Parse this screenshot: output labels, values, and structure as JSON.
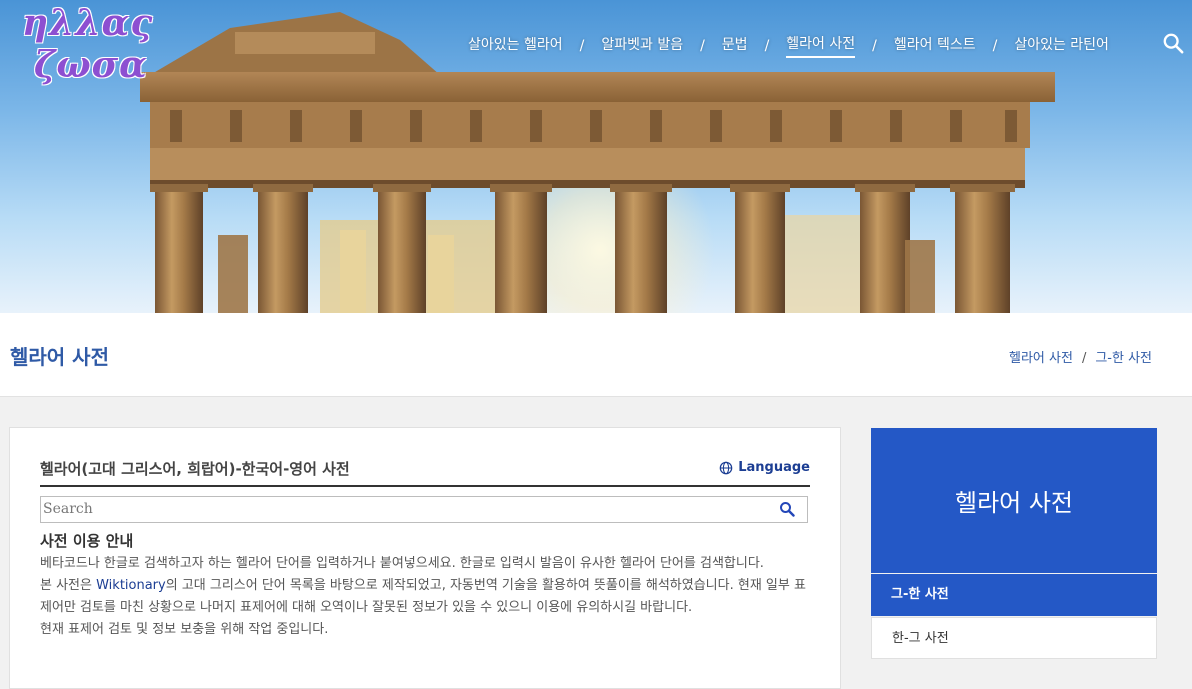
{
  "logo": {
    "line1": "ηλλας",
    "line2": "ζωσα"
  },
  "nav": [
    {
      "label": "살아있는 헬라어"
    },
    {
      "label": "알파벳과 발음"
    },
    {
      "label": "문법"
    },
    {
      "label": "헬라어 사전",
      "active": true
    },
    {
      "label": "헬라어 텍스트"
    },
    {
      "label": "살아있는 라틴어"
    }
  ],
  "nav_separator": "/",
  "page_title": "헬라어 사전",
  "breadcrumb": {
    "item1": "헬라어 사전",
    "sep": "/",
    "item2": "그-한 사전"
  },
  "card": {
    "heading": "헬라어(고대 그리스어, 희랍어)-한국어-영어 사전",
    "language_label": "Language",
    "search_placeholder": "Search",
    "guide_title": "사전 이용 안내",
    "guide_p1": "베타코드나 한글로 검색하고자 하는 헬라어 단어를 입력하거나 붙여넣으세요. 한글로 입력시 발음이 유사한 헬라어 단어를 검색합니다.",
    "guide_p2_pre": "본 사전은 ",
    "guide_p2_link": "Wiktionary",
    "guide_p2_post": "의 고대 그리스어 단어 목록을 바탕으로 제작되었고, 자동번역 기술을 활용하여 뜻풀이를 해석하였습니다. 현재 일부 표제어만 검토를 마친 상황으로 나머지 표제어에 대해 오역이나 잘못된 정보가 있을 수 있으니 이용에 유의하시길 바랍니다.",
    "guide_p3": "현재 표제어 검토 및 정보 보충을 위해 작업 중입니다."
  },
  "sidebar": {
    "title": "헬라어 사전",
    "items": [
      {
        "label": "그-한 사전",
        "active": true
      },
      {
        "label": "한-그 사전"
      }
    ]
  },
  "colors": {
    "accent": "#2458c6",
    "link": "#1c3e93",
    "title": "#2f5aa6"
  }
}
